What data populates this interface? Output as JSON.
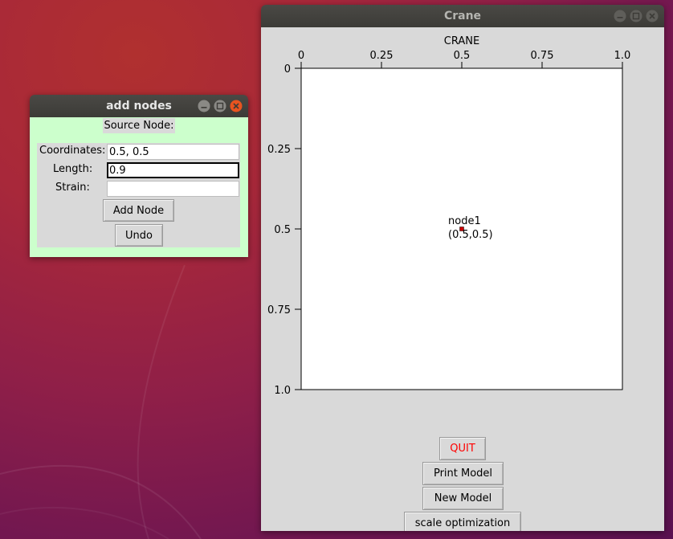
{
  "desktop": {
    "background_colors": [
      "#b0302f",
      "#8f1f48",
      "#5a1150"
    ]
  },
  "add_nodes_window": {
    "title": "add nodes",
    "buttons": {
      "minimize": "minimize-icon",
      "maximize": "maximize-icon",
      "close": "close-icon"
    },
    "source_node_label": "Source Node:",
    "fields": {
      "coordinates_label": "Coordinates:",
      "coordinates_value": "0.5, 0.5",
      "length_label": "Length:",
      "length_value": "0.9",
      "strain_label": "Strain:",
      "strain_value": ""
    },
    "add_node_label": "Add Node",
    "undo_label": "Undo",
    "background_color": "#ccffcc"
  },
  "crane_window": {
    "title": "Crane",
    "buttons": {
      "minimize": "minimize-icon",
      "maximize": "maximize-icon",
      "close": "close-icon"
    },
    "quit_label": "QUIT",
    "quit_color": "#ff0000",
    "print_model_label": "Print Model",
    "new_model_label": "New Model",
    "scale_optimization_label": "scale optimization"
  },
  "chart_data": {
    "type": "scatter",
    "title": "CRANE",
    "x_ticks": [
      "0",
      "0.25",
      "0.5",
      "0.75",
      "1.0"
    ],
    "y_ticks": [
      "0",
      "0.25",
      "0.5",
      "0.75",
      "1.0"
    ],
    "xlim": [
      0,
      1
    ],
    "ylim": [
      0,
      1
    ],
    "y_inverted": true,
    "x_axis_position": "top",
    "grid": false,
    "points": [
      {
        "name": "node1",
        "label": "(0.5,0.5)",
        "x": 0.5,
        "y": 0.5,
        "color": "#cc0000"
      }
    ]
  }
}
